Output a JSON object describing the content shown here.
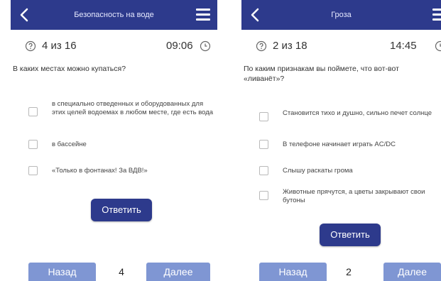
{
  "colors": {
    "header": "#2d3a8c",
    "submit_button": "#2d3a8c",
    "nav_button": "#7f96d3"
  },
  "icons": {
    "back": "chevron-left-icon",
    "menu": "hamburger-menu-icon",
    "help": "question-circle-icon",
    "timer": "clock-icon",
    "checkbox": "unchecked-checkbox"
  },
  "left": {
    "header": {
      "title": "Безопасность на воде"
    },
    "status": {
      "counter": "4 из 16",
      "timer": "09:06"
    },
    "question": "В каких местах можно купаться?",
    "answers": [
      {
        "text": "в специально отведенных и оборудованных для этих целей водоемах  в любом месте, где есть вода"
      },
      {
        "text": "в бассейне"
      },
      {
        "text": "«Только в фонтанах! За ВДВ!»"
      }
    ],
    "submit_label": "Ответить",
    "nav": {
      "prev_label": "Назад",
      "page": "4",
      "next_label": "Далее"
    }
  },
  "right": {
    "header": {
      "title": "Гроза"
    },
    "status": {
      "counter": "2 из 18",
      "timer": "14:45"
    },
    "question": "По каким признакам вы поймете, что вот-вот «ливанёт»?",
    "answers": [
      {
        "text": "Становится тихо и душно, сильно печет солнце"
      },
      {
        "text": "В телефоне начинает играть AC/DC"
      },
      {
        "text": "Слышу раскаты грома"
      },
      {
        "text": "Животные прячутся, а цветы закрывают свои бутоны"
      }
    ],
    "submit_label": "Ответить",
    "nav": {
      "prev_label": "Назад",
      "page": "2",
      "next_label": "Далее"
    }
  }
}
